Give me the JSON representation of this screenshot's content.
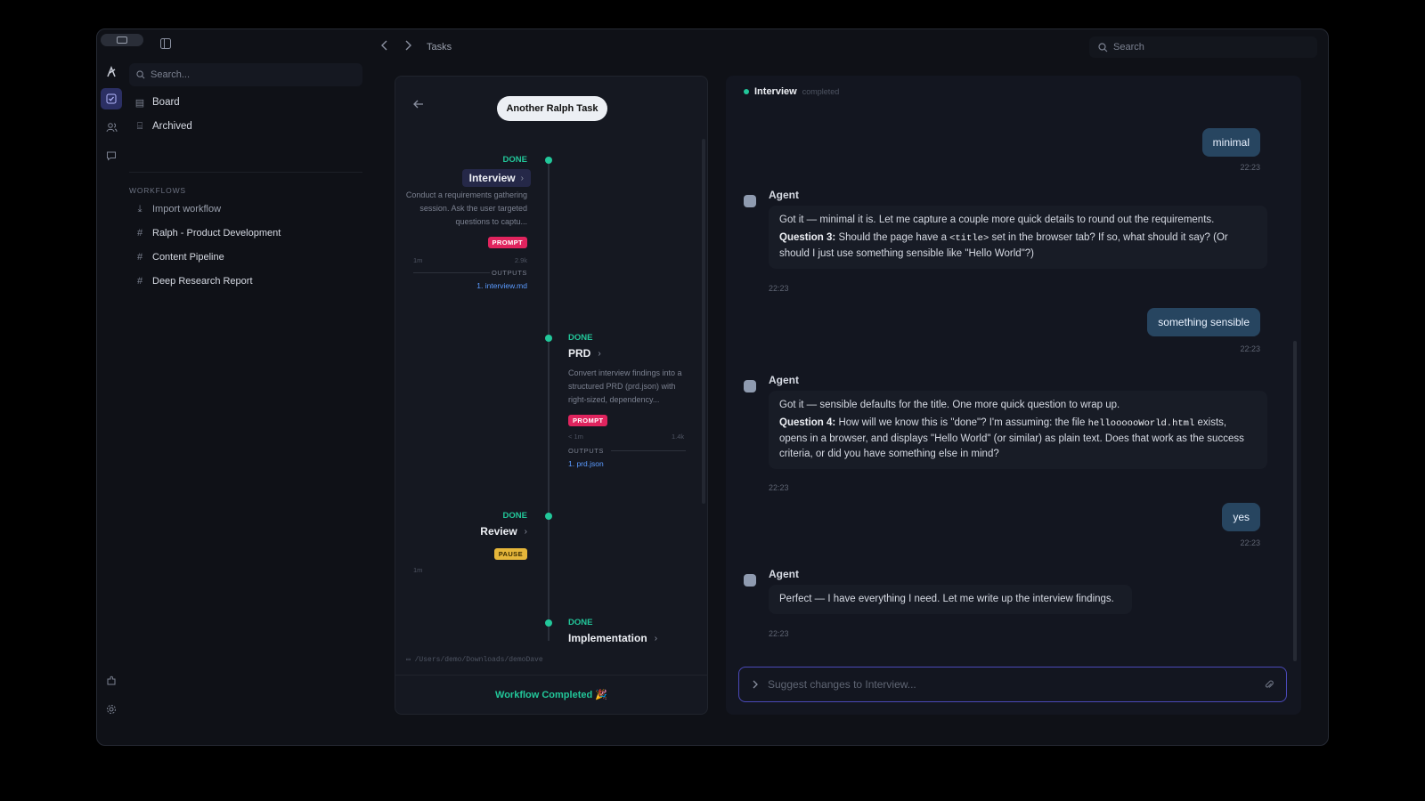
{
  "titlebar": {
    "breadcrumb": "Tasks",
    "search_label": "Search"
  },
  "sidebar": {
    "search_placeholder": "Search...",
    "items": [
      {
        "label": "Board"
      },
      {
        "label": "Archived"
      }
    ],
    "workflows_heading": "WORKFLOWS",
    "workflows": [
      {
        "label": "Import workflow",
        "icon": "import-icon"
      },
      {
        "label": "Ralph - Product Development",
        "icon": "hash-icon"
      },
      {
        "label": "Content Pipeline",
        "icon": "hash-icon"
      },
      {
        "label": "Deep Research Report",
        "icon": "hash-icon"
      }
    ]
  },
  "workflow": {
    "task_name": "Another Ralph Task",
    "stages": [
      {
        "status": "DONE",
        "title": "Interview",
        "description": "Conduct a requirements gathering session. Ask the user targeted questions to captu...",
        "badge": "PROMPT",
        "duration": "1m",
        "size": "2.9k",
        "outputs_label": "OUTPUTS",
        "output": "1. interview.md"
      },
      {
        "status": "DONE",
        "title": "PRD",
        "description": "Convert interview findings into a structured PRD (prd.json) with right-sized, dependency...",
        "badge": "PROMPT",
        "duration": "< 1m",
        "size": "1.4k",
        "outputs_label": "OUTPUTS",
        "output": "1. prd.json"
      },
      {
        "status": "DONE",
        "title": "Review",
        "badge": "PAUSE",
        "duration": "1m"
      },
      {
        "status": "DONE",
        "title": "Implementation"
      }
    ],
    "path": "/Users/demo/Downloads/demoDave",
    "completed_text": "Workflow Completed 🎉"
  },
  "chat": {
    "stage_name": "Interview",
    "stage_status": "completed",
    "messages": [
      {
        "role": "user",
        "text": "minimal",
        "time": "22:23"
      },
      {
        "role": "agent",
        "name": "Agent",
        "line1": "Got it — minimal it is. Let me capture a couple more quick details to round out the requirements.",
        "q_label": "Question 3:",
        "q_pre": "Should the page have a",
        "q_code": "<title>",
        "q_post": "set in the browser tab? If so, what should it say? (Or should I just use something sensible like \"Hello World\"?)",
        "time": "22:23"
      },
      {
        "role": "user",
        "text": "something sensible",
        "time": "22:23"
      },
      {
        "role": "agent",
        "name": "Agent",
        "line1": "Got it — sensible defaults for the title. One more quick question to wrap up.",
        "q_label": "Question 4:",
        "q_pre": "How will we know this is \"done\"? I'm assuming: the file",
        "q_code": "helloooooWorld.html",
        "q_post": "exists, opens in a browser, and displays \"Hello World\" (or similar) as plain text. Does that work as the success criteria, or did you have something else in mind?",
        "time": "22:23"
      },
      {
        "role": "user",
        "text": "yes",
        "time": "22:23"
      },
      {
        "role": "agent",
        "name": "Agent",
        "line1": "Perfect — I have everything I need. Let me write up the interview findings.",
        "time": "22:23"
      }
    ],
    "input_placeholder": "Suggest changes to Interview..."
  },
  "colors": {
    "accent_green": "#22c79a",
    "prompt_badge": "#e0245e",
    "pause_badge": "#e5b63a",
    "user_bubble": "#274560",
    "link": "#5b9bff"
  }
}
